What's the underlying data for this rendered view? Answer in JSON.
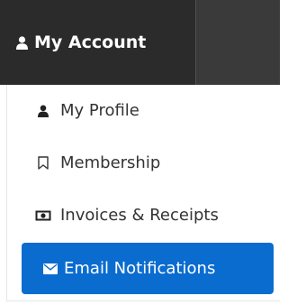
{
  "nav": {
    "account_label": "My Account",
    "account_icon": "user-icon"
  },
  "menu": {
    "items": [
      {
        "label": "My Profile",
        "icon": "user-icon"
      },
      {
        "label": "Membership",
        "icon": "bookmark-icon"
      },
      {
        "label": "Invoices & Receipts",
        "icon": "money-icon"
      },
      {
        "label": "Email Notifications",
        "icon": "envelope-icon",
        "active": true
      }
    ]
  },
  "colors": {
    "nav_bg": "#2b2b2b",
    "active_bg": "#0a6ccf"
  }
}
